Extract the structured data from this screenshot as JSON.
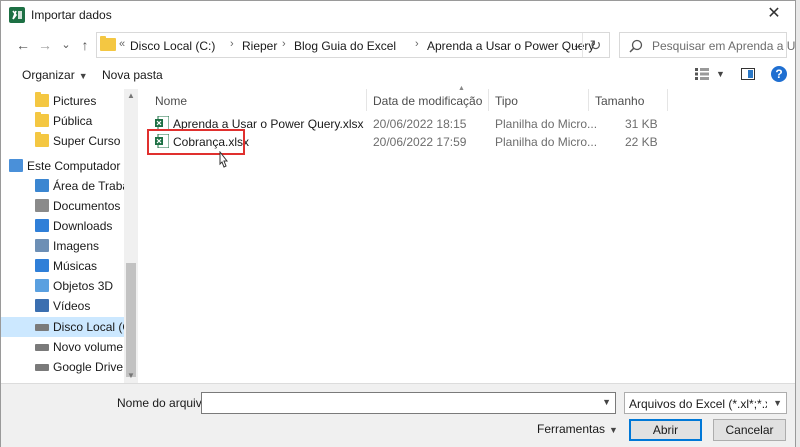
{
  "window": {
    "title": "Importar dados",
    "close_glyph": "✕"
  },
  "nav": {
    "back_glyph": "←",
    "forward_glyph": "→",
    "dropdown_glyph": "⌄",
    "up_glyph": "↑",
    "breadcrumb_overflow": "«",
    "breadcrumbs": [
      "Disco Local (C:)",
      "Rieper",
      "Blog Guia do Excel",
      "Aprenda a Usar o Power Query"
    ],
    "sep_glyph": "›",
    "refresh_glyph": "↻",
    "search_placeholder": "Pesquisar em Aprenda a Usar o..."
  },
  "toolbar": {
    "organize": "Organizar",
    "new_folder": "Nova pasta",
    "help": "?"
  },
  "tree": {
    "items": [
      {
        "label": "Pictures",
        "icon": "folder-icon"
      },
      {
        "label": "Pública",
        "icon": "folder-icon"
      },
      {
        "label": "Super Curso Das",
        "icon": "folder-icon"
      },
      {
        "label": "Este Computador",
        "icon": "computer-icon"
      },
      {
        "label": "Área de Trabalho",
        "icon": "desktop-icon"
      },
      {
        "label": "Documentos",
        "icon": "documents-icon"
      },
      {
        "label": "Downloads",
        "icon": "downloads-icon"
      },
      {
        "label": "Imagens",
        "icon": "pictures-icon"
      },
      {
        "label": "Músicas",
        "icon": "music-icon"
      },
      {
        "label": "Objetos 3D",
        "icon": "objects3d-icon"
      },
      {
        "label": "Vídeos",
        "icon": "videos-icon"
      },
      {
        "label": "Disco Local (C:)",
        "icon": "drive-icon"
      },
      {
        "label": "Novo volume (E",
        "icon": "drive-icon"
      },
      {
        "label": "Google Drive (G:",
        "icon": "drive-icon"
      }
    ]
  },
  "list": {
    "columns": [
      "Nome",
      "Data de modificação",
      "Tipo",
      "Tamanho"
    ],
    "rows": [
      {
        "name": "Aprenda a Usar o Power Query.xlsx",
        "date": "20/06/2022 18:15",
        "type": "Planilha do Micro...",
        "size": "31 KB"
      },
      {
        "name": "Cobrança.xlsx",
        "date": "20/06/2022 17:59",
        "type": "Planilha do Micro...",
        "size": "22 KB"
      }
    ]
  },
  "bottom": {
    "filename_label": "Nome do arquivo:",
    "filename_value": "",
    "filter_value": "Arquivos do Excel (*.xl*;*.xlsx;*.",
    "tools": "Ferramentas",
    "open": "Abrir",
    "cancel": "Cancelar"
  },
  "colors": {
    "accent": "#0078d7",
    "selection": "#cce8ff",
    "highlight_box": "#e0302e",
    "excel_green": "#1d7044"
  }
}
